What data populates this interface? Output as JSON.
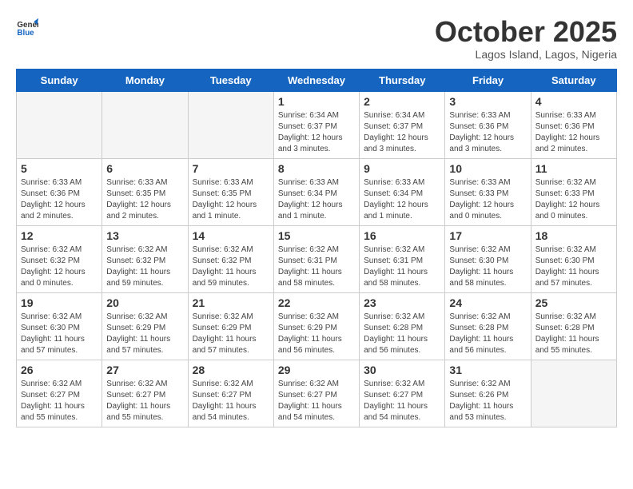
{
  "logo": {
    "general": "General",
    "blue": "Blue"
  },
  "title": "October 2025",
  "subtitle": "Lagos Island, Lagos, Nigeria",
  "headers": [
    "Sunday",
    "Monday",
    "Tuesday",
    "Wednesday",
    "Thursday",
    "Friday",
    "Saturday"
  ],
  "weeks": [
    [
      {
        "day": "",
        "info": ""
      },
      {
        "day": "",
        "info": ""
      },
      {
        "day": "",
        "info": ""
      },
      {
        "day": "1",
        "info": "Sunrise: 6:34 AM\nSunset: 6:37 PM\nDaylight: 12 hours\nand 3 minutes."
      },
      {
        "day": "2",
        "info": "Sunrise: 6:34 AM\nSunset: 6:37 PM\nDaylight: 12 hours\nand 3 minutes."
      },
      {
        "day": "3",
        "info": "Sunrise: 6:33 AM\nSunset: 6:36 PM\nDaylight: 12 hours\nand 3 minutes."
      },
      {
        "day": "4",
        "info": "Sunrise: 6:33 AM\nSunset: 6:36 PM\nDaylight: 12 hours\nand 2 minutes."
      }
    ],
    [
      {
        "day": "5",
        "info": "Sunrise: 6:33 AM\nSunset: 6:36 PM\nDaylight: 12 hours\nand 2 minutes."
      },
      {
        "day": "6",
        "info": "Sunrise: 6:33 AM\nSunset: 6:35 PM\nDaylight: 12 hours\nand 2 minutes."
      },
      {
        "day": "7",
        "info": "Sunrise: 6:33 AM\nSunset: 6:35 PM\nDaylight: 12 hours\nand 1 minute."
      },
      {
        "day": "8",
        "info": "Sunrise: 6:33 AM\nSunset: 6:34 PM\nDaylight: 12 hours\nand 1 minute."
      },
      {
        "day": "9",
        "info": "Sunrise: 6:33 AM\nSunset: 6:34 PM\nDaylight: 12 hours\nand 1 minute."
      },
      {
        "day": "10",
        "info": "Sunrise: 6:33 AM\nSunset: 6:33 PM\nDaylight: 12 hours\nand 0 minutes."
      },
      {
        "day": "11",
        "info": "Sunrise: 6:32 AM\nSunset: 6:33 PM\nDaylight: 12 hours\nand 0 minutes."
      }
    ],
    [
      {
        "day": "12",
        "info": "Sunrise: 6:32 AM\nSunset: 6:32 PM\nDaylight: 12 hours\nand 0 minutes."
      },
      {
        "day": "13",
        "info": "Sunrise: 6:32 AM\nSunset: 6:32 PM\nDaylight: 11 hours\nand 59 minutes."
      },
      {
        "day": "14",
        "info": "Sunrise: 6:32 AM\nSunset: 6:32 PM\nDaylight: 11 hours\nand 59 minutes."
      },
      {
        "day": "15",
        "info": "Sunrise: 6:32 AM\nSunset: 6:31 PM\nDaylight: 11 hours\nand 58 minutes."
      },
      {
        "day": "16",
        "info": "Sunrise: 6:32 AM\nSunset: 6:31 PM\nDaylight: 11 hours\nand 58 minutes."
      },
      {
        "day": "17",
        "info": "Sunrise: 6:32 AM\nSunset: 6:30 PM\nDaylight: 11 hours\nand 58 minutes."
      },
      {
        "day": "18",
        "info": "Sunrise: 6:32 AM\nSunset: 6:30 PM\nDaylight: 11 hours\nand 57 minutes."
      }
    ],
    [
      {
        "day": "19",
        "info": "Sunrise: 6:32 AM\nSunset: 6:30 PM\nDaylight: 11 hours\nand 57 minutes."
      },
      {
        "day": "20",
        "info": "Sunrise: 6:32 AM\nSunset: 6:29 PM\nDaylight: 11 hours\nand 57 minutes."
      },
      {
        "day": "21",
        "info": "Sunrise: 6:32 AM\nSunset: 6:29 PM\nDaylight: 11 hours\nand 57 minutes."
      },
      {
        "day": "22",
        "info": "Sunrise: 6:32 AM\nSunset: 6:29 PM\nDaylight: 11 hours\nand 56 minutes."
      },
      {
        "day": "23",
        "info": "Sunrise: 6:32 AM\nSunset: 6:28 PM\nDaylight: 11 hours\nand 56 minutes."
      },
      {
        "day": "24",
        "info": "Sunrise: 6:32 AM\nSunset: 6:28 PM\nDaylight: 11 hours\nand 56 minutes."
      },
      {
        "day": "25",
        "info": "Sunrise: 6:32 AM\nSunset: 6:28 PM\nDaylight: 11 hours\nand 55 minutes."
      }
    ],
    [
      {
        "day": "26",
        "info": "Sunrise: 6:32 AM\nSunset: 6:27 PM\nDaylight: 11 hours\nand 55 minutes."
      },
      {
        "day": "27",
        "info": "Sunrise: 6:32 AM\nSunset: 6:27 PM\nDaylight: 11 hours\nand 55 minutes."
      },
      {
        "day": "28",
        "info": "Sunrise: 6:32 AM\nSunset: 6:27 PM\nDaylight: 11 hours\nand 54 minutes."
      },
      {
        "day": "29",
        "info": "Sunrise: 6:32 AM\nSunset: 6:27 PM\nDaylight: 11 hours\nand 54 minutes."
      },
      {
        "day": "30",
        "info": "Sunrise: 6:32 AM\nSunset: 6:27 PM\nDaylight: 11 hours\nand 54 minutes."
      },
      {
        "day": "31",
        "info": "Sunrise: 6:32 AM\nSunset: 6:26 PM\nDaylight: 11 hours\nand 53 minutes."
      },
      {
        "day": "",
        "info": ""
      }
    ]
  ]
}
